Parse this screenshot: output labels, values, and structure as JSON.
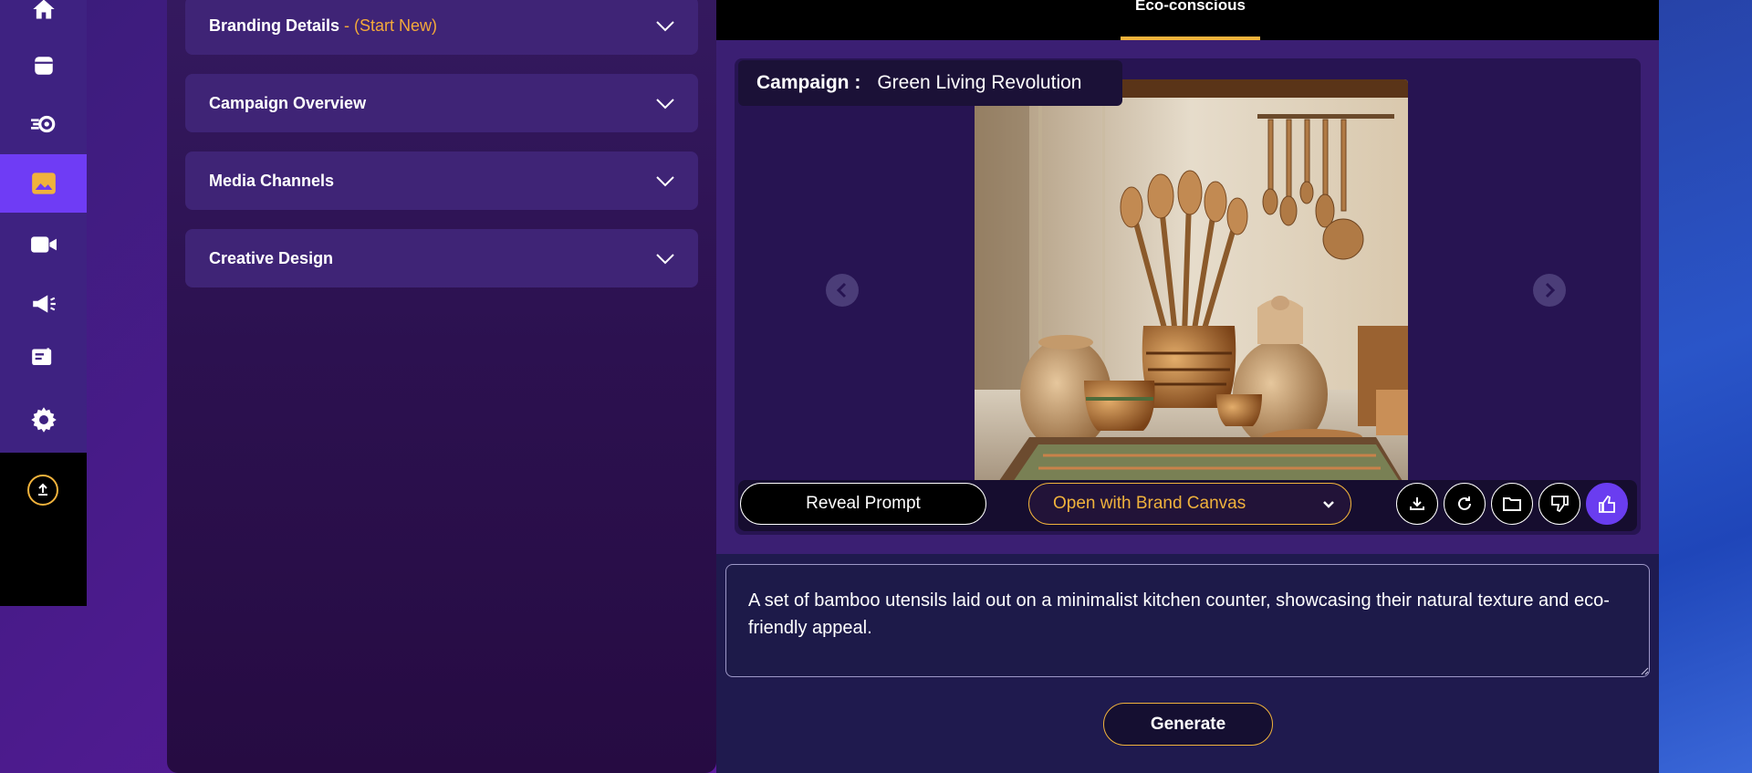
{
  "nav": {
    "items": [
      {
        "icon": "home-icon",
        "active": false
      },
      {
        "icon": "archive-icon",
        "active": false
      },
      {
        "icon": "workflow-icon",
        "active": false
      },
      {
        "icon": "image-icon",
        "active": true
      },
      {
        "icon": "video-icon",
        "active": false
      },
      {
        "icon": "megaphone-icon",
        "active": false
      },
      {
        "icon": "content-icon",
        "active": false
      },
      {
        "icon": "settings-icon",
        "active": false
      }
    ],
    "upload_icon": "upload-icon"
  },
  "form": {
    "sections": [
      {
        "title": "Branding Details",
        "suffix": " - (Start New)"
      },
      {
        "title": "Campaign Overview",
        "suffix": ""
      },
      {
        "title": "Media Channels",
        "suffix": ""
      },
      {
        "title": "Creative Design",
        "suffix": ""
      }
    ]
  },
  "tabs": {
    "active_label": "Eco-conscious"
  },
  "campaign": {
    "label": "Campaign :",
    "name": "Green Living Revolution"
  },
  "toolbar": {
    "reveal_label": "Reveal Prompt",
    "canvas_label": "Open with Brand Canvas",
    "icons": [
      "download-icon",
      "refresh-icon",
      "folder-icon",
      "thumbs-down-icon",
      "thumbs-up-icon"
    ]
  },
  "prompt": {
    "value": "A set of bamboo utensils laid out on a minimalist kitchen counter, showcasing their natural texture and eco-friendly appeal."
  },
  "actions": {
    "generate_label": "Generate"
  },
  "colors": {
    "accent": "#f0b23c",
    "active_nav": "#6f3cf5",
    "panel": "#3f2476"
  }
}
